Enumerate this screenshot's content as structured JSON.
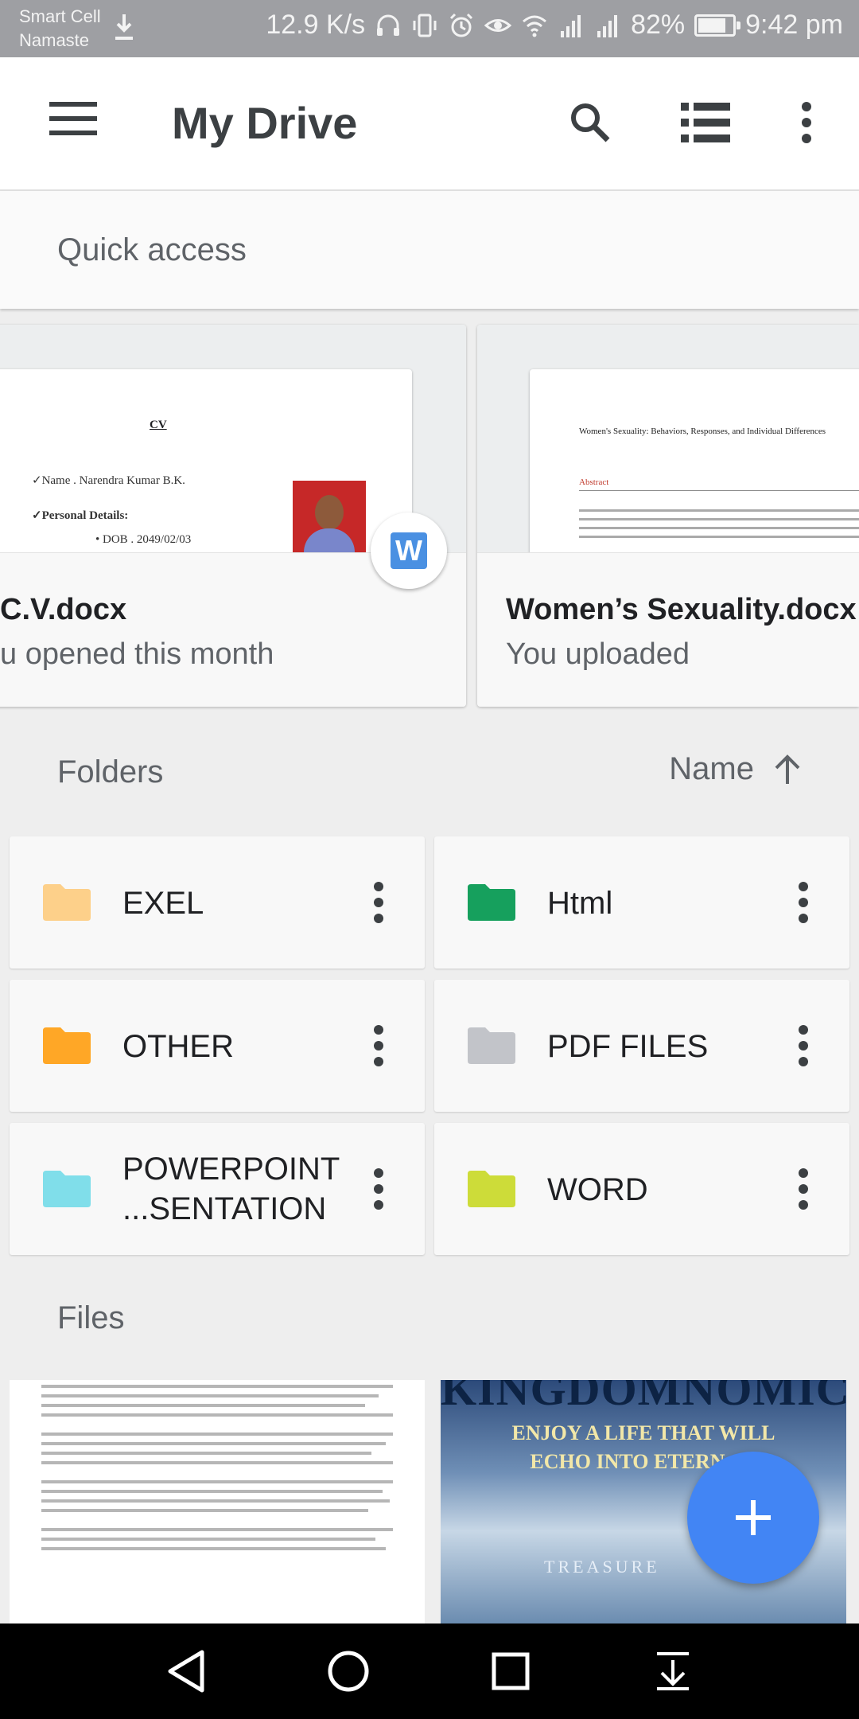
{
  "status_bar": {
    "carrier_line1": "Smart Cell",
    "carrier_line2": "Namaste",
    "net_speed": "12.9 K/s",
    "battery": "82%",
    "battery_level": 0.82,
    "time": "9:42 pm"
  },
  "toolbar": {
    "title": "My Drive"
  },
  "quick_access": {
    "title": "Quick access",
    "items": [
      {
        "name": "C.V.docx",
        "subtitle": "u opened this month",
        "preview_heading": "CV",
        "preview_line1": "✓Name . Narendra Kumar B.K.",
        "preview_line2": "✓Personal Details:",
        "preview_line3": "• DOB . 2049/02/03",
        "badge": "W"
      },
      {
        "name": "Women’s Sexuality.docx",
        "subtitle": "You uploaded",
        "preview_heading": "Women's Sexuality: Behaviors, Responses, and Individual Differences",
        "preview_section": "Abstract"
      }
    ]
  },
  "folders": {
    "title": "Folders",
    "sort_label": "Name",
    "items": [
      {
        "name": "EXEL",
        "color": "#fdd08a"
      },
      {
        "name": "Html",
        "color": "#16a05d"
      },
      {
        "name": "OTHER",
        "color": "#ffa726"
      },
      {
        "name": "PDF FILES",
        "color": "#c2c4c9"
      },
      {
        "name": "POWERPOINT",
        "name_line2": "...SENTATION",
        "color": "#80deea"
      },
      {
        "name": "WORD",
        "color": "#cddc39"
      }
    ]
  },
  "files": {
    "title": "Files",
    "items": [
      {
        "name": "document-preview"
      },
      {
        "title_text": "KINGDOMNOMICS",
        "line1": "ENJOY A LIFE THAT WILL",
        "line2": "ECHO INTO ETERN",
        "line3": "TREASURE"
      }
    ]
  },
  "colors": {
    "accent": "#4285f4",
    "status_bar": "#9e9fa3"
  }
}
